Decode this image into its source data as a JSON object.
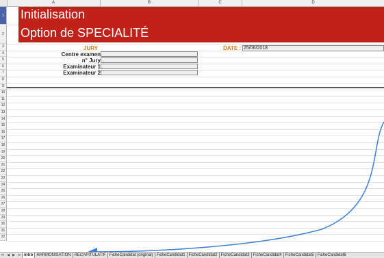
{
  "columns": [
    "A",
    "B",
    "C",
    "D"
  ],
  "rows": [
    "1",
    "2",
    "3",
    "4",
    "5",
    "6",
    "7",
    "8",
    "9",
    "10",
    "11",
    "12",
    "13",
    "14",
    "15",
    "16",
    "17",
    "18",
    "19",
    "20",
    "21",
    "22",
    "23",
    "24",
    "25",
    "26",
    "27",
    "28",
    "29",
    "30",
    "31",
    "32"
  ],
  "banner": {
    "title1": "Initialisation",
    "title2": "Option de SPECIALITÉ",
    "color": "#c0221a"
  },
  "form": {
    "jury_heading": "JURY",
    "date_label": "DATE :",
    "date_value": "25/06/2018",
    "fields": [
      {
        "label": "Centre examen",
        "value": ""
      },
      {
        "label": "n° Jury",
        "value": ""
      },
      {
        "label": "Examinateur 1",
        "value": ""
      },
      {
        "label": "Examinateur 2",
        "value": ""
      }
    ]
  },
  "sheet_tabs": {
    "nav": [
      "⏮",
      "◀",
      "▶",
      "⏭"
    ],
    "tabs": [
      "intro",
      "HARMONISATION",
      "RECAPITULATIF",
      "FicheCandidat (original)",
      "FicheCandidat1",
      "FicheCandidat2",
      "FicheCandidat3",
      "FicheCandidat4",
      "FicheCandidat5",
      "FicheCandidat6"
    ],
    "active_tab": "intro"
  },
  "annotation": {
    "arrow_color": "#3b7fd6",
    "arrow_icon": "curved-arrow-icon"
  }
}
